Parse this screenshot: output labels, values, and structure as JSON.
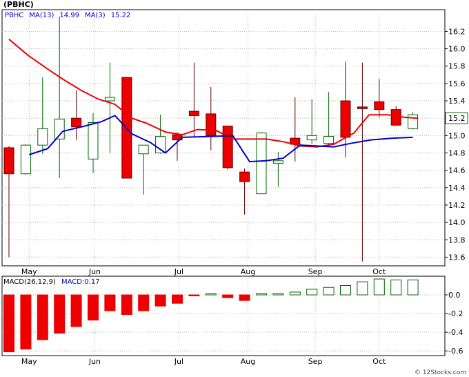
{
  "symbol_title": "(PBHC)",
  "footer": "© 12Stocks.com",
  "colors": {
    "up_candle": "#ffffff",
    "up_outline": "#006400",
    "down_candle": "#ee0000",
    "ma13": "#0000cc",
    "ma3": "#ee0000",
    "macd_down": "#ee0000",
    "macd_up": "#006400",
    "last_price_box": "#006400"
  },
  "chart_data": [
    {
      "type": "candlestick",
      "legend": [
        {
          "text": "PBHC",
          "color": "#0000cc"
        },
        {
          "text": "MA(13)",
          "color": "#0000cc"
        },
        {
          "text": "14.99",
          "color": "#0000cc"
        },
        {
          "text": "MA(3)",
          "color": "#0000cc"
        },
        {
          "text": "15.22",
          "color": "#0000cc"
        }
      ],
      "months": [
        "May",
        "Jun",
        "Jul",
        "Aug",
        "Sep",
        "Oct"
      ],
      "y_ticks": [
        "16.2",
        "16.0",
        "15.8",
        "15.6",
        "15.4",
        "15.2",
        "15.0",
        "14.8",
        "14.6",
        "14.4",
        "14.2",
        "14.0",
        "13.8",
        "13.6"
      ],
      "ylim": [
        13.5,
        16.45
      ],
      "last_price": "15.2",
      "candles": [
        {
          "o": 14.86,
          "h": 14.88,
          "l": 13.6,
          "c": 14.56
        },
        {
          "o": 14.56,
          "h": 14.9,
          "l": 14.55,
          "c": 14.89
        },
        {
          "o": 14.89,
          "h": 15.67,
          "l": 14.79,
          "c": 15.08
        },
        {
          "o": 14.96,
          "h": 16.37,
          "l": 14.51,
          "c": 15.19
        },
        {
          "o": 15.2,
          "h": 15.52,
          "l": 14.95,
          "c": 15.1
        },
        {
          "o": 14.73,
          "h": 15.26,
          "l": 14.57,
          "c": 15.15
        },
        {
          "o": 15.4,
          "h": 15.84,
          "l": 14.8,
          "c": 15.44
        },
        {
          "o": 15.67,
          "h": 15.67,
          "l": 14.51,
          "c": 14.51
        },
        {
          "o": 14.79,
          "h": 14.89,
          "l": 14.32,
          "c": 14.89
        },
        {
          "o": 14.8,
          "h": 15.24,
          "l": 14.79,
          "c": 14.99
        },
        {
          "o": 15.01,
          "h": 15.04,
          "l": 14.71,
          "c": 14.95
        },
        {
          "o": 15.28,
          "h": 15.84,
          "l": 14.98,
          "c": 15.23
        },
        {
          "o": 15.25,
          "h": 15.56,
          "l": 14.83,
          "c": 15.0
        },
        {
          "o": 15.11,
          "h": 15.11,
          "l": 14.61,
          "c": 14.63
        },
        {
          "o": 14.58,
          "h": 14.62,
          "l": 14.09,
          "c": 14.47
        },
        {
          "o": 14.33,
          "h": 15.04,
          "l": 14.33,
          "c": 15.03
        },
        {
          "o": 14.68,
          "h": 14.81,
          "l": 14.41,
          "c": 14.71
        },
        {
          "o": 14.97,
          "h": 15.44,
          "l": 14.7,
          "c": 14.9
        },
        {
          "o": 14.95,
          "h": 15.42,
          "l": 14.9,
          "c": 15.0
        },
        {
          "o": 14.91,
          "h": 15.5,
          "l": 14.88,
          "c": 14.99
        },
        {
          "o": 15.4,
          "h": 15.85,
          "l": 14.75,
          "c": 14.98
        },
        {
          "o": 15.33,
          "h": 15.84,
          "l": 13.55,
          "c": 15.31
        },
        {
          "o": 15.39,
          "h": 15.65,
          "l": 15.21,
          "c": 15.3
        },
        {
          "o": 15.3,
          "h": 15.34,
          "l": 15.11,
          "c": 15.12
        },
        {
          "o": 15.08,
          "h": 15.27,
          "l": 15.07,
          "c": 15.24
        }
      ],
      "ma13": [
        {
          "i": 1.2,
          "v": 14.78
        },
        {
          "i": 2.3,
          "v": 14.85
        },
        {
          "i": 3.2,
          "v": 15.05
        },
        {
          "i": 4.3,
          "v": 15.1
        },
        {
          "i": 5.5,
          "v": 15.16
        },
        {
          "i": 6.3,
          "v": 15.23
        },
        {
          "i": 7.3,
          "v": 15.02
        },
        {
          "i": 8.4,
          "v": 14.92
        },
        {
          "i": 9.3,
          "v": 14.8
        },
        {
          "i": 10.3,
          "v": 14.98
        },
        {
          "i": 12.0,
          "v": 14.99
        },
        {
          "i": 13.3,
          "v": 15.0
        },
        {
          "i": 14.3,
          "v": 14.7
        },
        {
          "i": 15.3,
          "v": 14.71
        },
        {
          "i": 16.3,
          "v": 14.74
        },
        {
          "i": 17.3,
          "v": 14.89
        },
        {
          "i": 18.3,
          "v": 14.88
        },
        {
          "i": 19.3,
          "v": 14.87
        },
        {
          "i": 20.3,
          "v": 14.91
        },
        {
          "i": 21.5,
          "v": 14.95
        },
        {
          "i": 22.8,
          "v": 14.97
        },
        {
          "i": 24.0,
          "v": 14.98
        }
      ],
      "ma3": [
        {
          "i": 0.0,
          "v": 16.11
        },
        {
          "i": 1.1,
          "v": 15.93
        },
        {
          "i": 2.2,
          "v": 15.78
        },
        {
          "i": 3.2,
          "v": 15.65
        },
        {
          "i": 4.3,
          "v": 15.52
        },
        {
          "i": 5.3,
          "v": 15.42
        },
        {
          "i": 6.3,
          "v": 15.36
        },
        {
          "i": 7.3,
          "v": 15.2
        },
        {
          "i": 8.2,
          "v": 15.14
        },
        {
          "i": 9.3,
          "v": 15.04
        },
        {
          "i": 10.3,
          "v": 15.01
        },
        {
          "i": 11.2,
          "v": 15.07
        },
        {
          "i": 12.3,
          "v": 15.06
        },
        {
          "i": 13.3,
          "v": 14.96
        },
        {
          "i": 14.3,
          "v": 14.96
        },
        {
          "i": 15.3,
          "v": 14.96
        },
        {
          "i": 16.3,
          "v": 14.93
        },
        {
          "i": 17.3,
          "v": 14.88
        },
        {
          "i": 18.3,
          "v": 14.87
        },
        {
          "i": 19.3,
          "v": 14.9
        },
        {
          "i": 20.5,
          "v": 15.03
        },
        {
          "i": 21.4,
          "v": 15.24
        },
        {
          "i": 22.5,
          "v": 15.24
        },
        {
          "i": 23.5,
          "v": 15.21
        },
        {
          "i": 24.3,
          "v": 15.2
        }
      ]
    },
    {
      "type": "bar",
      "legend": [
        {
          "text": "MACD(26,12,9)",
          "color": "#000000"
        },
        {
          "text": "MACD:0.17",
          "color": "#0000cc"
        }
      ],
      "y_ticks": [
        "0.0",
        "-0.2",
        "-0.4",
        "-0.6"
      ],
      "ylim": [
        -0.65,
        0.2
      ],
      "values": [
        -0.61,
        -0.58,
        -0.48,
        -0.41,
        -0.34,
        -0.27,
        -0.17,
        -0.21,
        -0.17,
        -0.12,
        -0.09,
        -0.01,
        0.0,
        -0.03,
        -0.06,
        0.0,
        0.0,
        0.03,
        0.06,
        0.08,
        0.1,
        0.14,
        0.17,
        0.16,
        0.16
      ]
    }
  ]
}
